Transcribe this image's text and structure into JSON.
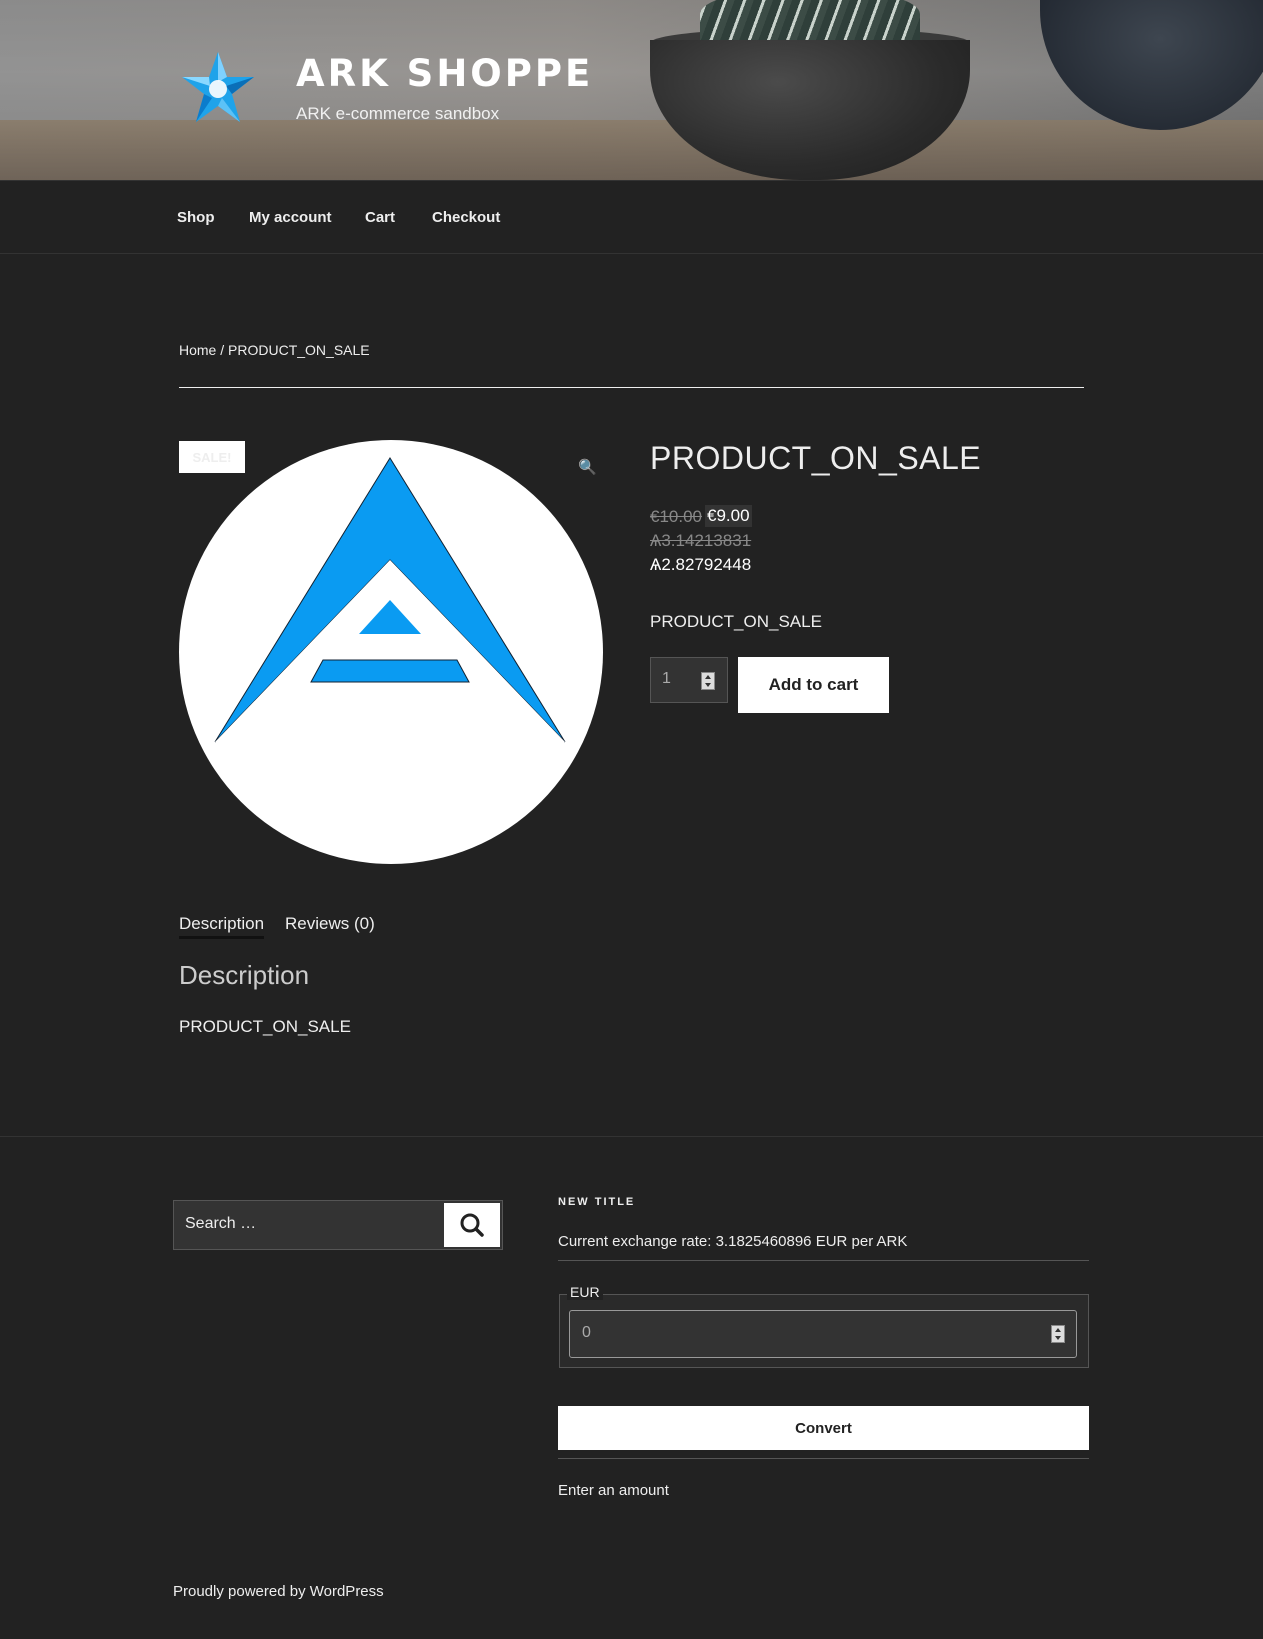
{
  "header": {
    "site_title": "ARK SHOPPE",
    "tagline": "ARK e-commerce sandbox"
  },
  "nav": {
    "items": [
      {
        "label": "Shop"
      },
      {
        "label": "My account"
      },
      {
        "label": "Cart"
      },
      {
        "label": "Checkout"
      }
    ]
  },
  "breadcrumb": {
    "home": "Home",
    "separator": "/",
    "current": "PRODUCT_ON_SALE"
  },
  "product": {
    "sale_badge": "SALE!",
    "zoom_icon": "magnifier-icon",
    "title": "PRODUCT_ON_SALE",
    "price_regular": "€10.00",
    "price_sale": "€9.00",
    "ark_regular": "Ѧ3.14213831",
    "ark_sale": "Ѧ2.82792448",
    "short_description": "PRODUCT_ON_SALE",
    "quantity": "1",
    "add_to_cart": "Add to cart"
  },
  "tabs": [
    {
      "label": "Description",
      "active": true
    },
    {
      "label": "Reviews (0)",
      "active": false
    }
  ],
  "description": {
    "heading": "Description",
    "body": "PRODUCT_ON_SALE"
  },
  "footer": {
    "search_placeholder": "Search …",
    "widget_title": "NEW TITLE",
    "exchange_rate": "Current exchange rate: 3.1825460896 EUR per ARK",
    "currency_legend": "EUR",
    "amount_value": "0",
    "convert_button": "Convert",
    "result_text": "Enter an amount",
    "powered_by": "Proudly powered by WordPress"
  },
  "colors": {
    "background": "#222222",
    "ark_blue": "#0a9bf2",
    "text": "#eeeeee"
  }
}
